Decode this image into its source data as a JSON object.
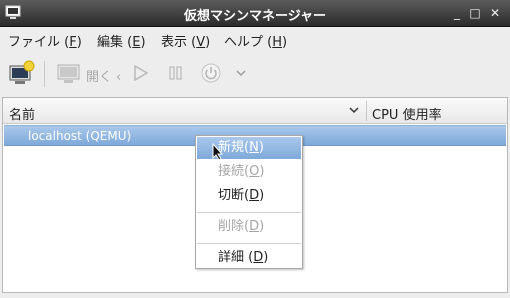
{
  "window": {
    "title": "仮想マシンマネージャー",
    "buttons": {
      "minimize": "_",
      "maximize": "□",
      "close": "✕"
    }
  },
  "menubar": {
    "items": [
      {
        "label": "ファイル (",
        "key": "F",
        "suffix": ")"
      },
      {
        "label": "編集 (",
        "key": "E",
        "suffix": ")"
      },
      {
        "label": "表示 (",
        "key": "V",
        "suffix": ")"
      },
      {
        "label": "ヘルプ (",
        "key": "H",
        "suffix": ")"
      }
    ]
  },
  "toolbar": {
    "open_label": "開く"
  },
  "table": {
    "columns": {
      "name": "名前",
      "cpu": "CPU 使用率"
    },
    "rows": [
      {
        "label": "localhost (QEMU)"
      }
    ]
  },
  "context_menu": {
    "items": [
      {
        "label": "新規(",
        "key": "N",
        "suffix": ")",
        "state": "hover"
      },
      {
        "label": "接続(",
        "key": "O",
        "suffix": ")",
        "state": "disabled"
      },
      {
        "label": "切断(",
        "key": "D",
        "suffix": ")",
        "state": "enabled"
      },
      {
        "label": "削除(",
        "key": "D",
        "suffix": ")",
        "state": "disabled"
      },
      {
        "label": "詳細 (",
        "key": "D",
        "suffix": ")",
        "state": "enabled"
      }
    ]
  }
}
